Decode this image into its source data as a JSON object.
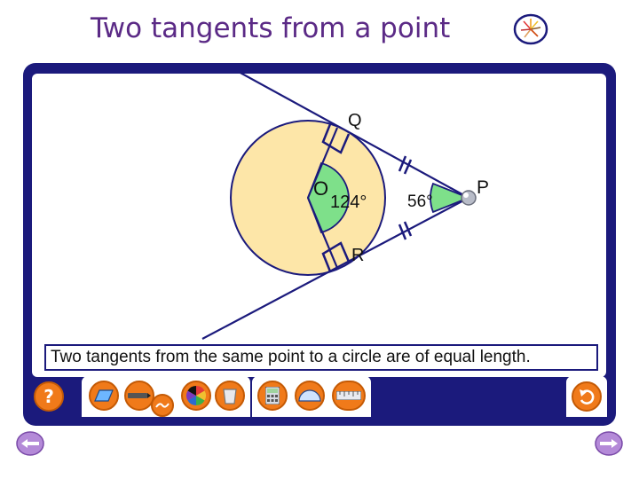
{
  "slide": {
    "title": "Two tangents from a point"
  },
  "diagram": {
    "labels": {
      "center": "O",
      "tangent_point_top": "Q",
      "tangent_point_bottom": "R",
      "external_point": "P"
    },
    "angle_at_center": "124°",
    "angle_at_p": "56°",
    "caption": "Two tangents from the same point to a circle are of equal length."
  },
  "colors": {
    "frame": "#1b1a7c",
    "circle_fill": "#fde6a8",
    "angle_fill": "#7ee08a",
    "button": "#f07a1a",
    "title": "#5b2a86"
  },
  "toolbar": {
    "help_icon": "question-mark-icon",
    "help_label": "?",
    "tools": [
      "eraser-icon",
      "pen-icon",
      "color-wheel-icon",
      "bin-icon",
      "calculator-icon",
      "protractor-icon",
      "ruler-icon"
    ],
    "undo_icon": "undo-arrow-icon"
  },
  "navigation": {
    "prev_icon": "back-arrow-icon",
    "next_icon": "forward-arrow-icon"
  }
}
